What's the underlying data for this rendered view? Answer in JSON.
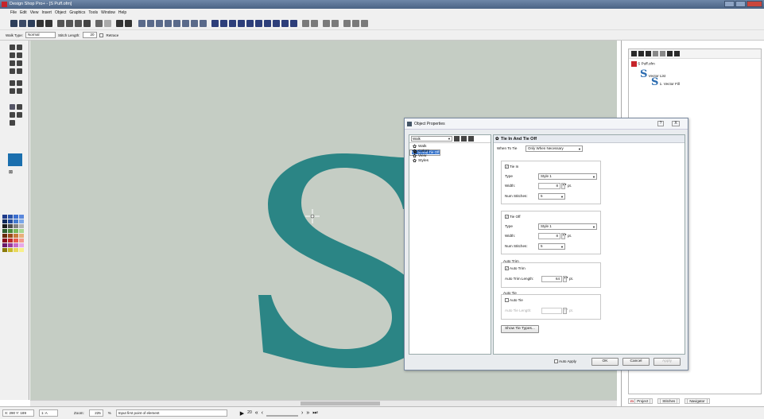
{
  "window": {
    "title": "Design Shop Pro+ - [S Puff.ofm]"
  },
  "menu": [
    "File",
    "Edit",
    "View",
    "Insert",
    "Object",
    "Graphics",
    "Tools",
    "Window",
    "Help"
  ],
  "toolbar2": {
    "walk_type_label": "Walk Type:",
    "walk_type_value": "Normal",
    "stitch_length_label": "Stitch Length:",
    "stitch_length_value": "20",
    "retrace_label": "Retrace"
  },
  "palette_colors": [
    "#1f3c8a",
    "#2a53a8",
    "#3c6fcf",
    "#5b88dc",
    "#102a5c",
    "#224a9a",
    "#447bd0",
    "#7aa6e8",
    "#1c1c1c",
    "#4a4a4a",
    "#808080",
    "#b4b4b4",
    "#2f5f2f",
    "#4c8c3c",
    "#78b85a",
    "#a8d890",
    "#6a2a0a",
    "#9a4a1a",
    "#c87a3a",
    "#e8b07a",
    "#8a0a1a",
    "#c02a2a",
    "#e85a4a",
    "#f49a8a",
    "#6a1a6a",
    "#9a3a9a",
    "#c86ac8",
    "#e8a8e8",
    "#8a7a0a",
    "#c8b82a",
    "#e8d85a",
    "#f8f08a"
  ],
  "canvas": {
    "letter": "S",
    "letter_color": "#2b8585",
    "bg": "#c5cdc4"
  },
  "status": {
    "coords": "X: 290  Y: 189",
    "layer": "1: A",
    "zoom_label": "Zoom:",
    "zoom_value": "225",
    "zoom_unit": "%",
    "prompt": "Input first point of element",
    "frame": "20"
  },
  "rightpanel": {
    "file": "S Puff.ofm",
    "vector_list": "Vector List",
    "vector_fill": "1. Vector Fill",
    "tabs": [
      "Project",
      "Stitches",
      "Navigator"
    ]
  },
  "dialog": {
    "title": "Object Properties",
    "help": "?",
    "close": "X",
    "category_combo": "Walk",
    "tree": [
      "Walk",
      "Tie In And Tie Off",
      "Colors",
      "View",
      "Styles"
    ],
    "selected_tree_index": 1,
    "section_title": "Tie In And Tie Off",
    "when_to_tie_label": "When To Tie",
    "when_to_tie_value": "Only When Necessary",
    "tie_in": {
      "label": "Tie In",
      "type_label": "Type",
      "type_value": "Style 1",
      "width_label": "Width:",
      "width_value": "8",
      "unit": "pt.",
      "num_label": "Num Stitches:",
      "num_value": "5"
    },
    "tie_off": {
      "label": "Tie Off",
      "type_label": "Type",
      "type_value": "Style 1",
      "width_label": "Width:",
      "width_value": "8",
      "unit": "pt.",
      "num_label": "Num Stitches:",
      "num_value": "5"
    },
    "auto_trim": {
      "group": "Auto Trim",
      "label": "Auto Trim",
      "length_label": "Auto Trim Length:",
      "length_value": "64",
      "unit": "pt."
    },
    "auto_tie": {
      "group": "Auto Tie",
      "label": "Auto Tie",
      "length_label": "Auto Tie Length:",
      "length_value": "",
      "unit": "pt."
    },
    "show_tie_types": "Show Tie Types...",
    "auto_apply": "Auto Apply",
    "ok": "OK",
    "cancel": "Cancel",
    "apply": "Apply"
  }
}
